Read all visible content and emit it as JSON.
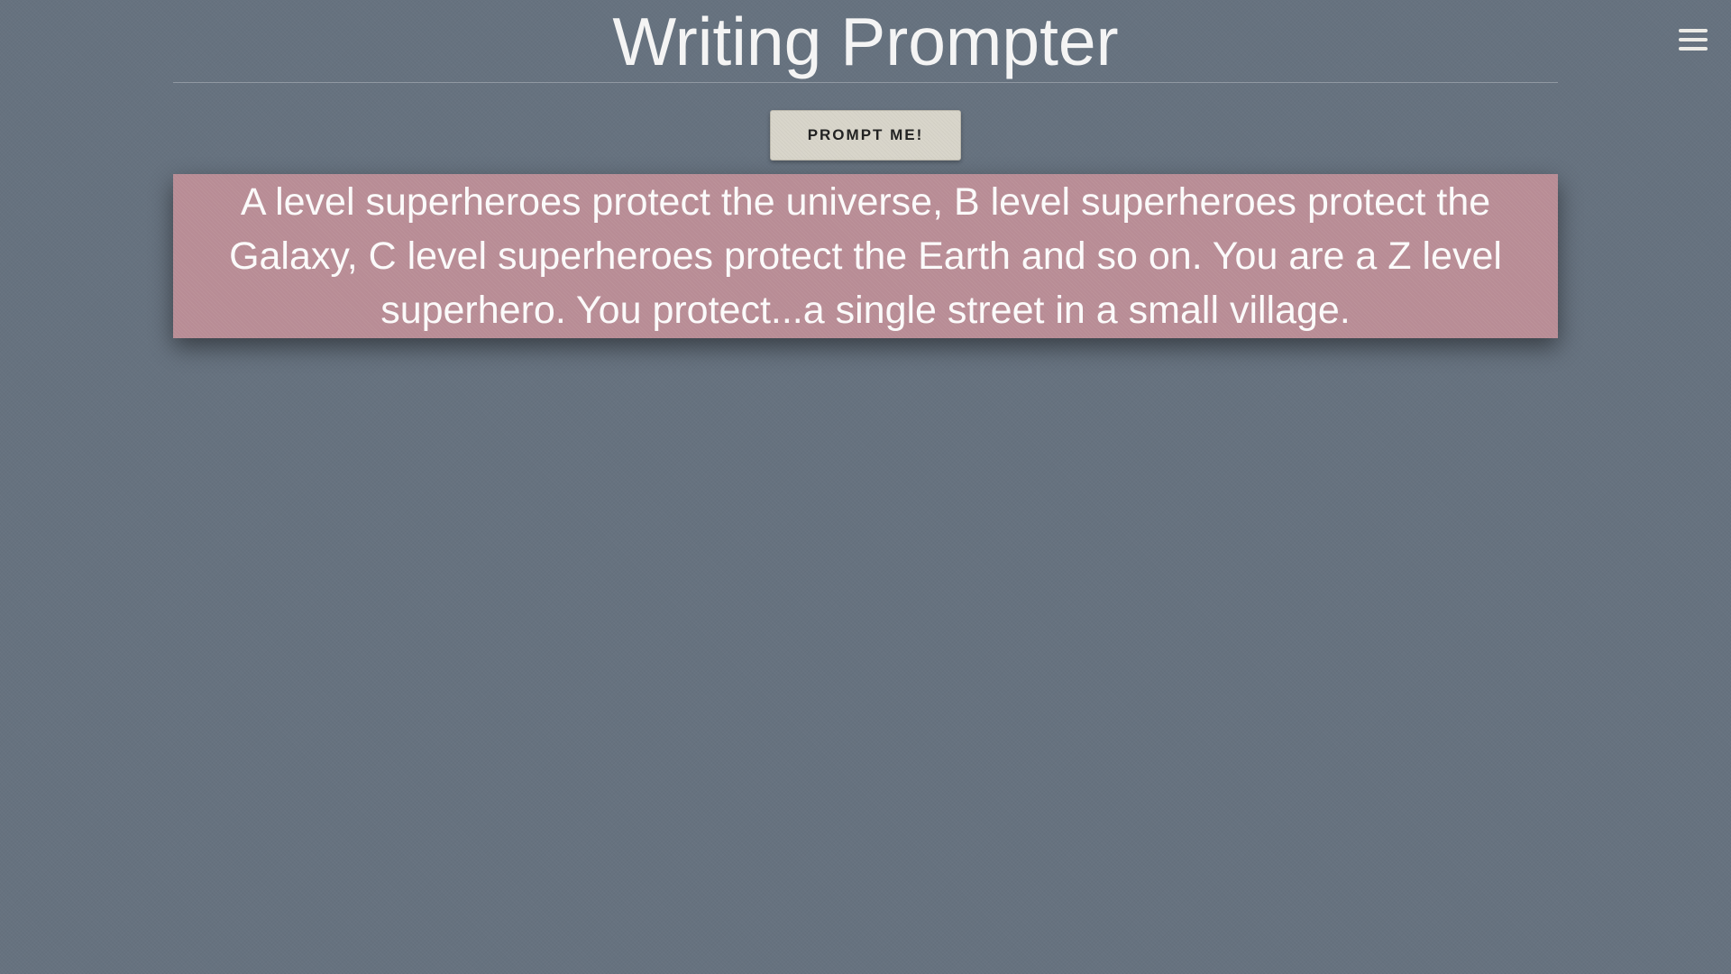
{
  "header": {
    "title": "Writing Prompter",
    "menu_icon": "hamburger-menu-icon"
  },
  "controls": {
    "prompt_button_label": "PROMPT ME!"
  },
  "prompt": {
    "text": "A level superheroes protect the universe, B level superheroes protect the Galaxy, C level superheroes protect the Earth and so on. You are a Z level superhero. You protect...a single street in a small village."
  },
  "colors": {
    "background": "#66727f",
    "prompt_card": "#b88c95",
    "button": "#d9d6cb",
    "text": "#f4f4f4"
  }
}
